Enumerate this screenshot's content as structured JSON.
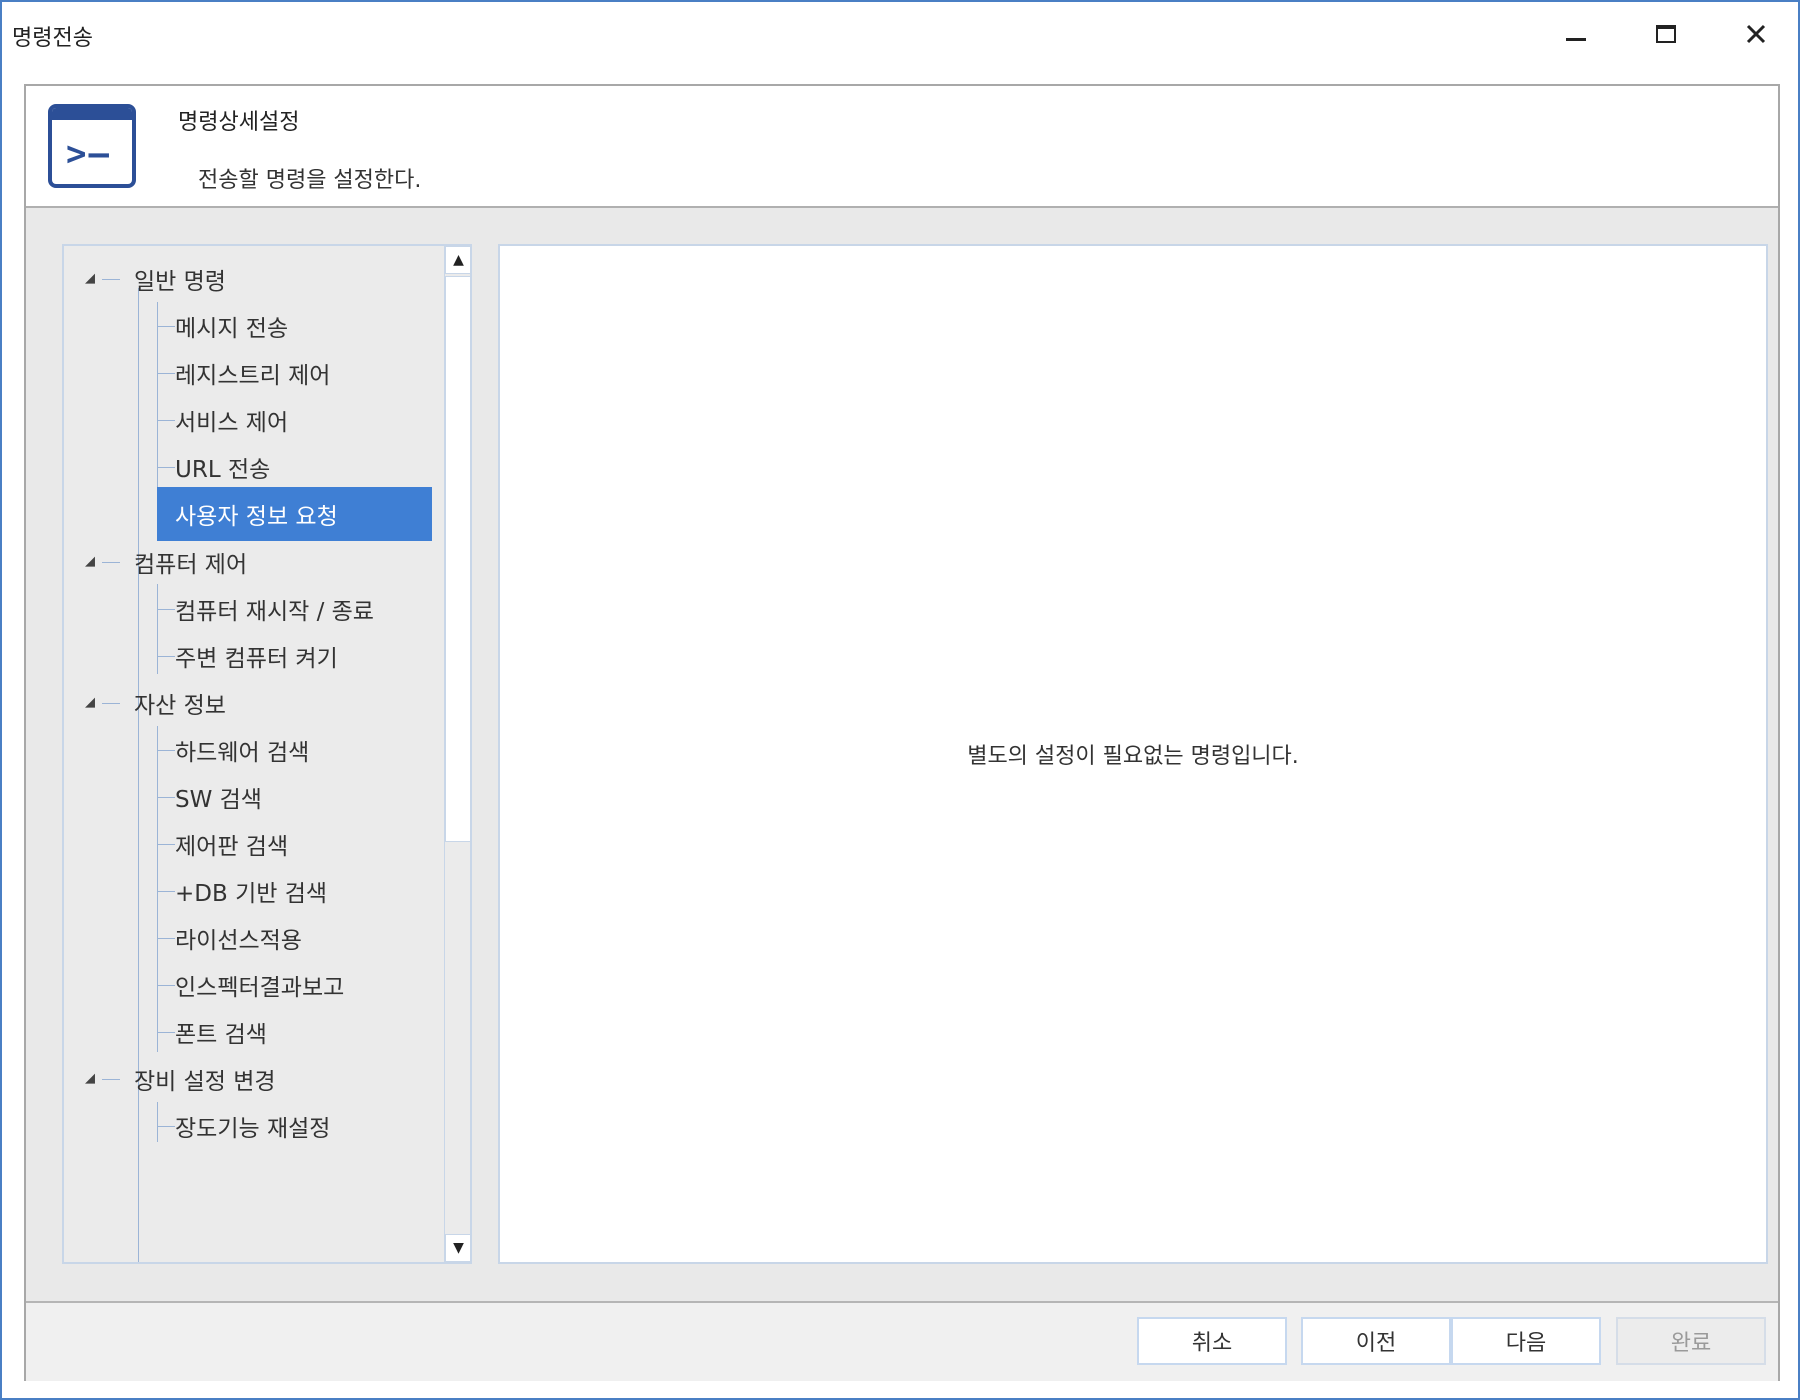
{
  "window": {
    "title": "명령전송"
  },
  "header": {
    "title": "명령상세설정",
    "subtitle": "전송할 명령을 설정한다.",
    "icon": "terminal-icon",
    "icon_color": "#2c4f97"
  },
  "tree": {
    "groups": [
      {
        "label": "일반 명령",
        "items": [
          "메시지 전송",
          "레지스트리 제어",
          "서비스 제어",
          "URL 전송",
          "사용자 정보 요청"
        ]
      },
      {
        "label": "컴퓨터 제어",
        "items": [
          "컴퓨터 재시작 / 종료",
          "주변 컴퓨터 켜기"
        ]
      },
      {
        "label": "자산 정보",
        "items": [
          "하드웨어 검색",
          "SW 검색",
          "제어판 검색",
          "+DB 기반 검색",
          "라이선스적용",
          "인스펙터결과보고",
          "폰트 검색"
        ]
      },
      {
        "label": "장비 설정 변경",
        "items": [
          "장도기능 재설정"
        ]
      }
    ],
    "selected": "사용자 정보 요청",
    "selected_color": "#3f7fd4"
  },
  "content": {
    "message": "별도의 설정이 필요없는 명령입니다."
  },
  "footer": {
    "cancel": "취소",
    "prev": "이전",
    "next": "다음",
    "finish": "완료"
  },
  "colors": {
    "window_border": "#4a7fc4",
    "panel_border": "#c8d6e8"
  }
}
